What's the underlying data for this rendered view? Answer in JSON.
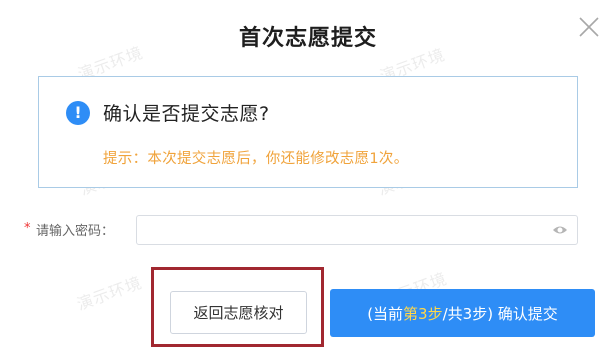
{
  "dialog": {
    "title": "首次志愿提交"
  },
  "notice": {
    "icon": "info-icon",
    "question": "确认是否提交志愿?",
    "tip": "提示：本次提交志愿后，你还能修改志愿1次。"
  },
  "password": {
    "required_mark": "*",
    "label": "请输入密码：",
    "value": "",
    "placeholder": ""
  },
  "buttons": {
    "back_label": "返回志愿核对",
    "confirm_prefix": "(当前",
    "confirm_step": "第3步",
    "confirm_suffix": "/共3步) 确认提交"
  },
  "watermark": "演示环境",
  "colors": {
    "primary": "#2e8df6",
    "tip": "#f0a33b",
    "highlight_border": "#a12830",
    "notice_border": "#a9cbe6",
    "step_highlight": "#ffd84a"
  }
}
